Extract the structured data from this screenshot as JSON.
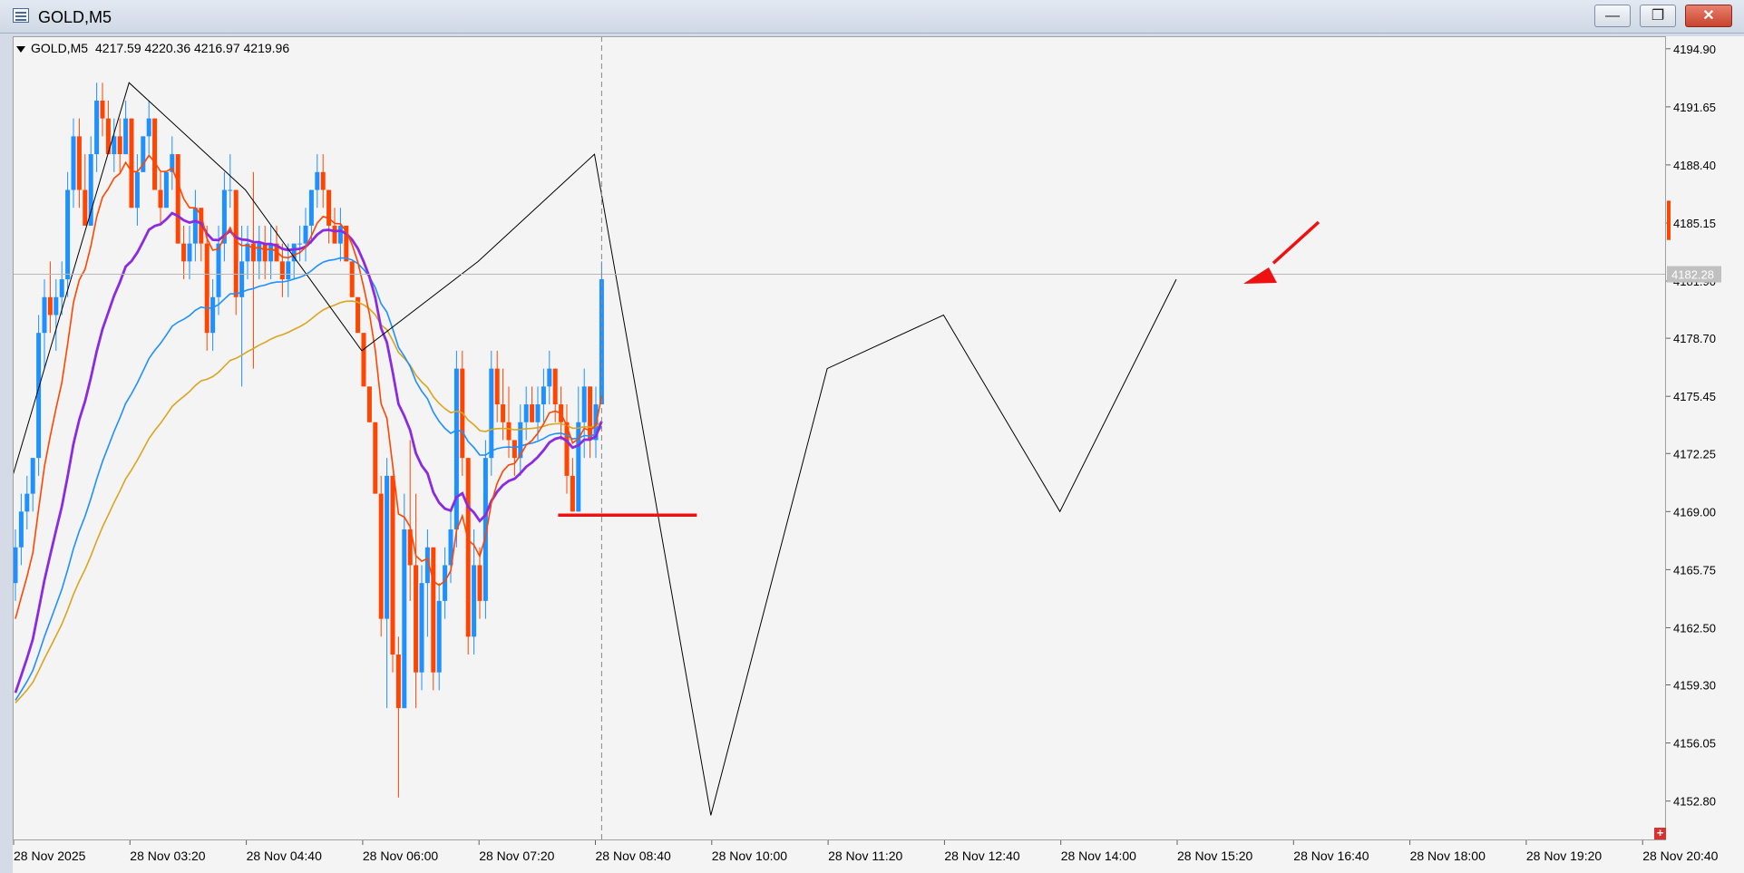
{
  "window": {
    "title": "GOLD,M5",
    "minimize": "—",
    "restore": "❐",
    "close": "✕"
  },
  "header": {
    "symbol": "GOLD,M5",
    "open": "4217.59",
    "high": "4220.36",
    "low": "4216.97",
    "close": "4219.96"
  },
  "current_price_label": "4182.28",
  "colors": {
    "bull": "#1e90ff",
    "bear": "#ff4500",
    "ema_red": "#ff4500",
    "ema_purple": "#8a2be2",
    "ema_blue": "#1e90ff",
    "ema_gold": "#daa520",
    "zigzag": "#000000",
    "annotation": "#ee1111"
  },
  "chart_data": {
    "type": "candlestick",
    "title": "GOLD,M5",
    "ylim": [
      4150.6,
      4195.6
    ],
    "y_ticks": [
      "4194.90",
      "4191.65",
      "4188.40",
      "4185.15",
      "4181.90",
      "4178.70",
      "4175.45",
      "4172.25",
      "4169.00",
      "4165.75",
      "4162.50",
      "4159.30",
      "4156.05",
      "4152.80"
    ],
    "x_ticks": [
      "28 Nov 2025",
      "28 Nov 03:20",
      "28 Nov 04:40",
      "28 Nov 06:00",
      "28 Nov 07:20",
      "28 Nov 08:40",
      "28 Nov 10:00",
      "28 Nov 11:20",
      "28 Nov 12:40",
      "28 Nov 14:00",
      "28 Nov 15:20",
      "28 Nov 16:40",
      "28 Nov 18:00",
      "28 Nov 19:20",
      "28 Nov 20:40"
    ],
    "candles_ohlc": [
      [
        4165,
        4168,
        4164,
        4167
      ],
      [
        4167,
        4170,
        4166,
        4169
      ],
      [
        4169,
        4171,
        4168,
        4170
      ],
      [
        4170,
        4172,
        4169,
        4172
      ],
      [
        4172,
        4180,
        4171,
        4179
      ],
      [
        4179,
        4182,
        4177,
        4181
      ],
      [
        4181,
        4183,
        4179,
        4180
      ],
      [
        4180,
        4182,
        4178,
        4181
      ],
      [
        4181,
        4183,
        4180,
        4182
      ],
      [
        4182,
        4188,
        4181,
        4187
      ],
      [
        4187,
        4191,
        4186,
        4190
      ],
      [
        4190,
        4191,
        4186,
        4187
      ],
      [
        4187,
        4189,
        4185,
        4185
      ],
      [
        4185,
        4190,
        4185,
        4189
      ],
      [
        4189,
        4193,
        4188,
        4192
      ],
      [
        4192,
        4193,
        4190,
        4191
      ],
      [
        4191,
        4192,
        4189,
        4189
      ],
      [
        4189,
        4191,
        4188,
        4190
      ],
      [
        4190,
        4191,
        4188,
        4189
      ],
      [
        4189,
        4192,
        4189,
        4191
      ],
      [
        4191,
        4191,
        4186,
        4186
      ],
      [
        4186,
        4189,
        4185,
        4188
      ],
      [
        4188,
        4190,
        4188,
        4190
      ],
      [
        4190,
        4192,
        4189,
        4191
      ],
      [
        4191,
        4191,
        4187,
        4187
      ],
      [
        4187,
        4188,
        4185,
        4186
      ],
      [
        4186,
        4188,
        4186,
        4188
      ],
      [
        4188,
        4190,
        4187,
        4189
      ],
      [
        4189,
        4189,
        4184,
        4184
      ],
      [
        4184,
        4185,
        4182,
        4183
      ],
      [
        4183,
        4185,
        4182,
        4184
      ],
      [
        4184,
        4187,
        4183,
        4186
      ],
      [
        4186,
        4186,
        4183,
        4184
      ],
      [
        4184,
        4185,
        4178,
        4179
      ],
      [
        4179,
        4182,
        4178,
        4181
      ],
      [
        4181,
        4185,
        4180,
        4184
      ],
      [
        4184,
        4188,
        4183,
        4187
      ],
      [
        4187,
        4189,
        4186,
        4187
      ],
      [
        4187,
        4187,
        4180,
        4181
      ],
      [
        4181,
        4185,
        4176,
        4183
      ],
      [
        4183,
        4185,
        4182,
        4184
      ],
      [
        4184,
        4188,
        4177,
        4183
      ],
      [
        4183,
        4185,
        4182,
        4184
      ],
      [
        4184,
        4185,
        4182,
        4183
      ],
      [
        4183,
        4185,
        4182,
        4184
      ],
      [
        4184,
        4185,
        4183,
        4183
      ],
      [
        4183,
        4184,
        4181,
        4182
      ],
      [
        4182,
        4184,
        4181,
        4183
      ],
      [
        4183,
        4184,
        4182,
        4184
      ],
      [
        4184,
        4185,
        4183,
        4184
      ],
      [
        4184,
        4186,
        4183,
        4185
      ],
      [
        4185,
        4187,
        4184,
        4187
      ],
      [
        4187,
        4189,
        4186,
        4188
      ],
      [
        4188,
        4189,
        4186,
        4187
      ],
      [
        4187,
        4187,
        4184,
        4185
      ],
      [
        4185,
        4186,
        4184,
        4184
      ],
      [
        4184,
        4186,
        4183,
        4185
      ],
      [
        4185,
        4185,
        4183,
        4183
      ],
      [
        4183,
        4183,
        4181,
        4181
      ],
      [
        4181,
        4181,
        4179,
        4179
      ],
      [
        4179,
        4179,
        4176,
        4176
      ],
      [
        4176,
        4176,
        4174,
        4174
      ],
      [
        4174,
        4174,
        4170,
        4170
      ],
      [
        4170,
        4171,
        4162,
        4163
      ],
      [
        4163,
        4172,
        4158,
        4171
      ],
      [
        4171,
        4171,
        4160,
        4161
      ],
      [
        4161,
        4162,
        4153,
        4158
      ],
      [
        4158,
        4170,
        4158,
        4168
      ],
      [
        4168,
        4173,
        4164,
        4166
      ],
      [
        4166,
        4170,
        4158,
        4160
      ],
      [
        4160,
        4166,
        4159,
        4165
      ],
      [
        4165,
        4168,
        4162,
        4167
      ],
      [
        4167,
        4167,
        4159,
        4160
      ],
      [
        4160,
        4165,
        4159,
        4164
      ],
      [
        4164,
        4167,
        4163,
        4166
      ],
      [
        4166,
        4169,
        4165,
        4168
      ],
      [
        4168,
        4178,
        4167,
        4177
      ],
      [
        4177,
        4178,
        4171,
        4172
      ],
      [
        4172,
        4172,
        4161,
        4162
      ],
      [
        4162,
        4168,
        4161,
        4166
      ],
      [
        4166,
        4167,
        4163,
        4164
      ],
      [
        4164,
        4173,
        4163,
        4172
      ],
      [
        4172,
        4178,
        4171,
        4177
      ],
      [
        4177,
        4178,
        4174,
        4175
      ],
      [
        4175,
        4177,
        4173,
        4174
      ],
      [
        4174,
        4176,
        4172,
        4173
      ],
      [
        4173,
        4173,
        4171,
        4172
      ],
      [
        4172,
        4175,
        4171,
        4174
      ],
      [
        4174,
        4176,
        4173,
        4175
      ],
      [
        4175,
        4176,
        4174,
        4174
      ],
      [
        4174,
        4176,
        4173,
        4175
      ],
      [
        4175,
        4177,
        4174,
        4176
      ],
      [
        4176,
        4178,
        4175,
        4177
      ],
      [
        4177,
        4177,
        4174,
        4175
      ],
      [
        4175,
        4176,
        4173,
        4174
      ],
      [
        4174,
        4175,
        4170,
        4171
      ],
      [
        4171,
        4172,
        4169,
        4169
      ],
      [
        4169,
        4176,
        4169,
        4174
      ],
      [
        4174,
        4177,
        4172,
        4176
      ],
      [
        4176,
        4176,
        4172,
        4173
      ],
      [
        4173,
        4176,
        4172,
        4175
      ],
      [
        4175,
        4183,
        4175,
        4182
      ]
    ],
    "ema_series_names": [],
    "zigzag": [
      {
        "x": "28 Nov 2025",
        "y": 4171
      },
      {
        "x": "28 Nov 03:20",
        "y": 4193
      },
      {
        "x": "28 Nov 04:40",
        "y": 4187
      },
      {
        "x": "28 Nov 06:00",
        "y": 4178
      },
      {
        "x": "28 Nov 07:20",
        "y": 4183
      },
      {
        "x": "28 Nov 08:40",
        "y": 4189
      },
      {
        "x": "28 Nov 10:00",
        "y": 4152
      },
      {
        "x": "28 Nov 11:20",
        "y": 4177
      },
      {
        "x": "28 Nov 12:40",
        "y": 4180
      },
      {
        "x": "28 Nov 14:00",
        "y": 4169
      },
      {
        "x": "28 Nov 15:20",
        "y": 4182
      }
    ],
    "support_line_price": 4168.8,
    "grid": false
  }
}
